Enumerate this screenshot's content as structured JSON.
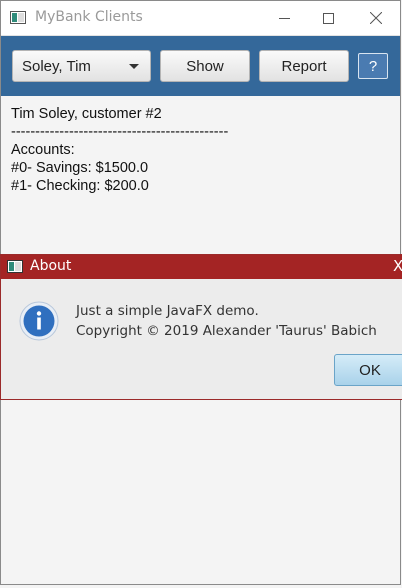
{
  "window": {
    "title": "MyBank Clients",
    "icon": "app-window-icon",
    "controls": {
      "minimize": "minimize-icon",
      "maximize": "maximize-icon",
      "close": "close-icon"
    }
  },
  "toolbar": {
    "customer_select": {
      "selected": "Soley, Tim"
    },
    "show_label": "Show",
    "report_label": "Report",
    "help_label": "?",
    "background": "#34689a"
  },
  "output": {
    "lines": [
      "Tim Soley, customer #2",
      "---------------------------------------------",
      "Accounts:",
      "#0- Savings: $1500.0",
      "#1- Checking: $200.0"
    ]
  },
  "about_dialog": {
    "title": "About",
    "close_glyph": "X",
    "message_line1": "Just a simple JavaFX demo.",
    "message_line2": "Copyright © 2019 Alexander 'Taurus' Babich",
    "ok_label": "OK",
    "icon": "info-icon",
    "title_bar_color": "#a42424"
  }
}
